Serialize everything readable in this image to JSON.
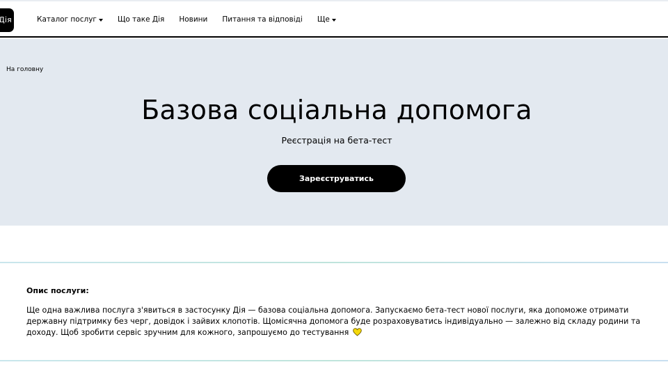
{
  "header": {
    "logo_text": "Дія",
    "nav": [
      {
        "label": "Каталог послуг",
        "dropdown": true
      },
      {
        "label": "Що таке Дія",
        "dropdown": false
      },
      {
        "label": "Новини",
        "dropdown": false
      },
      {
        "label": "Питання та відповіді",
        "dropdown": false
      },
      {
        "label": "Ще",
        "dropdown": true
      }
    ]
  },
  "hero": {
    "breadcrumb": "На головну",
    "title": "Базова соціальна допомога",
    "subtitle": "Реєстрація на бета-тест",
    "cta_label": "Зареєструватись"
  },
  "description": {
    "title": "Опис послуги:",
    "text": "Ще одна важлива послуга з'явиться в застосунку Дія — базова соціальна допомога. Запускаємо бета-тест нової послуги, яка допоможе отримати державну підтримку без черг, довідок і зайвих клопотів. Щомісячна допомога буде розраховуватись індивідуально — залежно від складу родини та доходу. Щоб зробити сервіс зручним для кожного, запрошуємо до тестування",
    "end_icon": "yellow-heart-icon"
  },
  "colors": {
    "hero_bg": "#e3e9f0",
    "button_bg": "#000000",
    "heart": "#f5d90a"
  }
}
